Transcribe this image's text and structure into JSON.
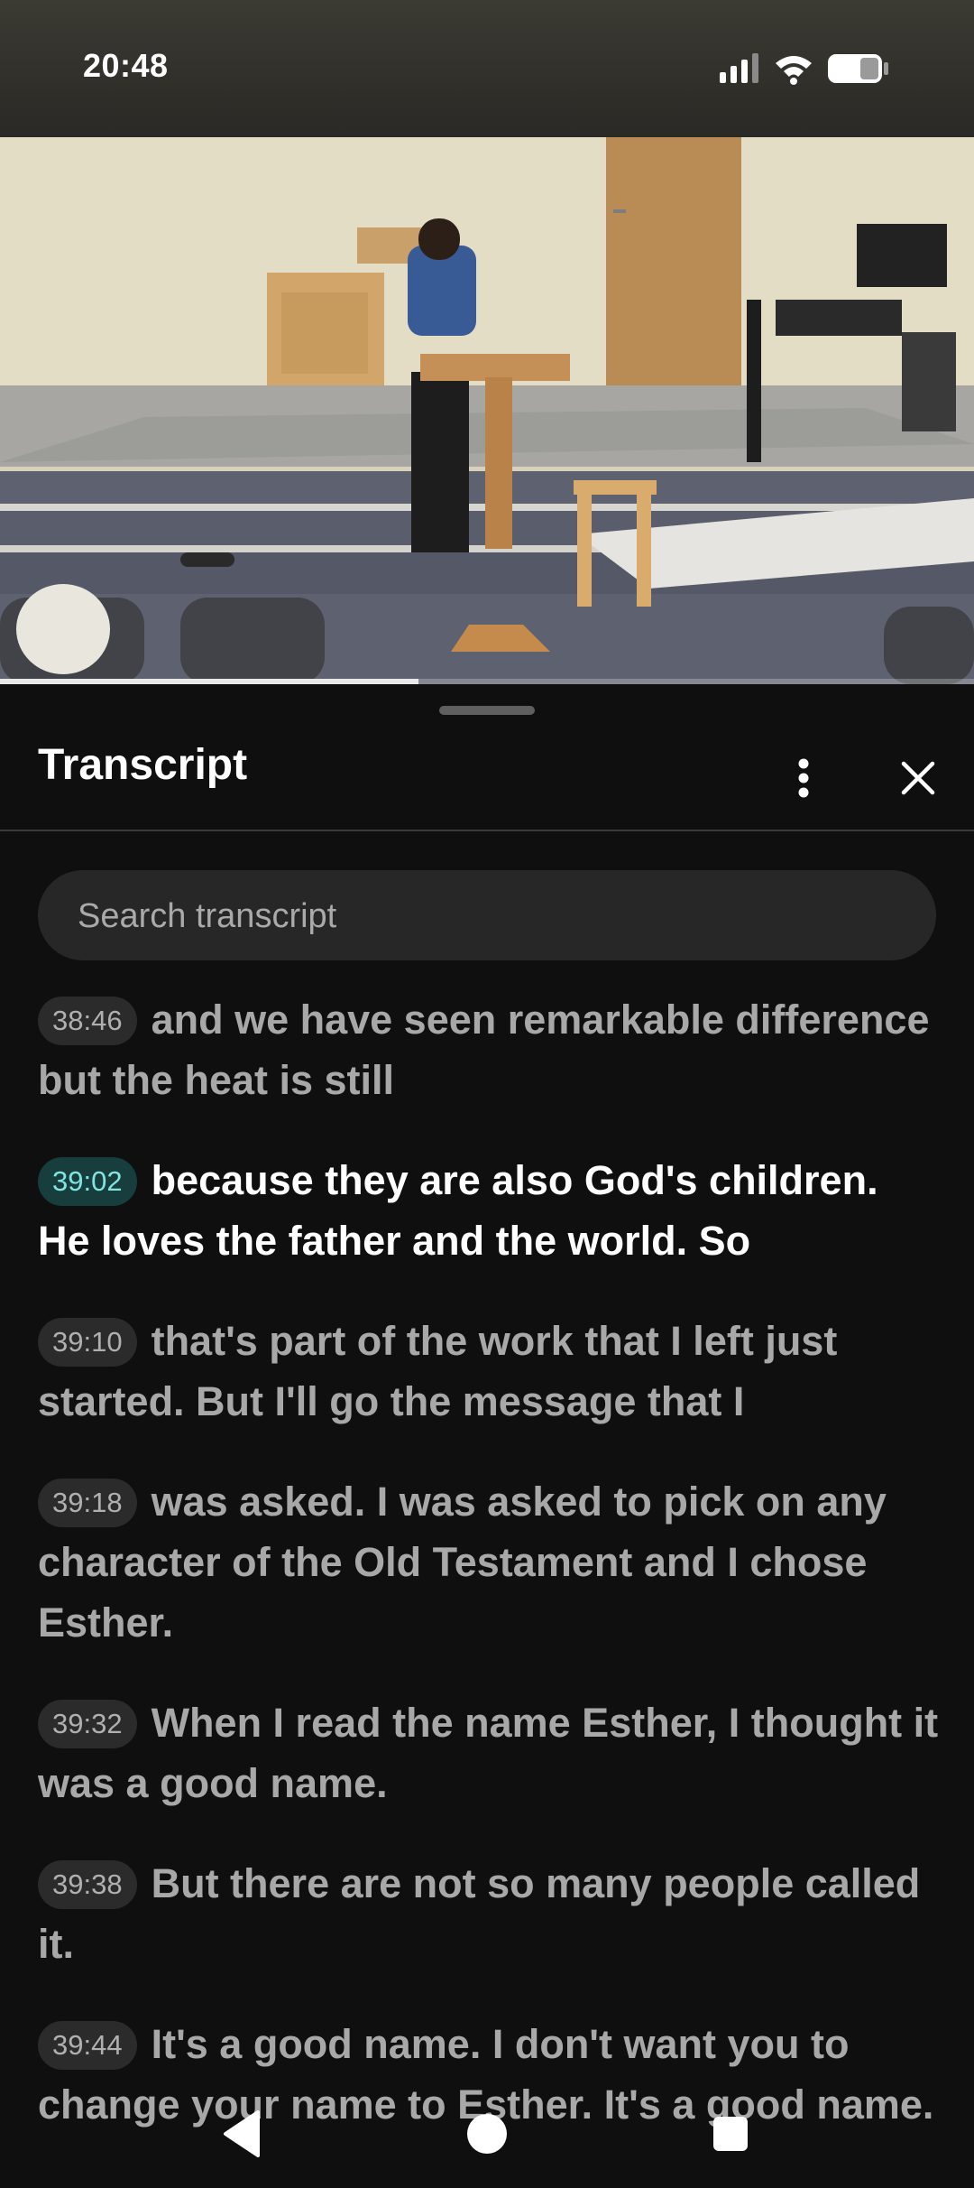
{
  "status_bar": {
    "time": "20:48",
    "icons": [
      "signal-icon",
      "wifi-icon",
      "battery-icon"
    ]
  },
  "video": {
    "description_icon": "video-frame",
    "progress_fraction": 0.43
  },
  "transcript": {
    "title": "Transcript",
    "more_icon": "more-vert-icon",
    "close_icon": "close-icon",
    "search": {
      "placeholder": "Search transcript",
      "value": ""
    },
    "segments": [
      {
        "time": "38:46",
        "text": "and we have seen remarkable difference but the heat is still",
        "active": false
      },
      {
        "time": "39:02",
        "text": "because they are also God's children. He loves the father and the world. So",
        "active": true
      },
      {
        "time": "39:10",
        "text": "that's part of the work that I left just started. But I'll go the message that I",
        "active": false
      },
      {
        "time": "39:18",
        "text": "was asked. I was asked to pick on any character of the Old Testament and I chose Esther.",
        "active": false
      },
      {
        "time": "39:32",
        "text": "When I read the name Esther, I thought it was a good name.",
        "active": false
      },
      {
        "time": "39:38",
        "text": "But there are not so many people called it.",
        "active": false
      },
      {
        "time": "39:44",
        "text": "It's a good name. I don't want you to change your name to Esther. It's a good name.",
        "active": false
      }
    ]
  },
  "nav_bar": {
    "icons": [
      "back-icon",
      "home-icon",
      "recents-icon"
    ]
  },
  "colors": {
    "background": "#0f0f0f",
    "active_timestamp_bg": "#173d3d",
    "active_timestamp_text": "#7fe4e2",
    "inactive_text": "#a8a8a8"
  }
}
